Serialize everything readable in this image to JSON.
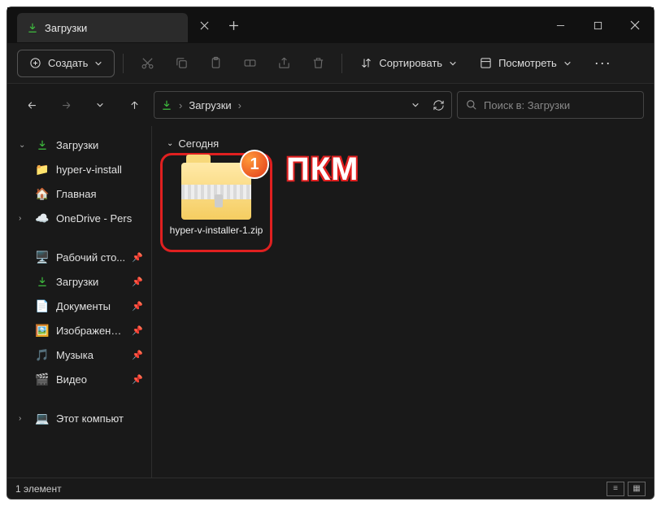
{
  "tab": {
    "title": "Загрузки"
  },
  "toolbar": {
    "create": "Создать",
    "sort": "Сортировать",
    "view": "Посмотреть"
  },
  "breadcrumb": {
    "item": "Загрузки"
  },
  "search": {
    "placeholder": "Поиск в: Загрузки"
  },
  "sidebar": {
    "downloads": "Загрузки",
    "child_file": "hyper-v-install",
    "home": "Главная",
    "onedrive": "OneDrive - Pers",
    "desktop": "Рабочий сто...",
    "downloads2": "Загрузки",
    "documents": "Документы",
    "pictures": "Изображени...",
    "music": "Музыка",
    "videos": "Видео",
    "this_pc": "Этот компьют"
  },
  "content": {
    "group": "Сегодня",
    "file_name": "hyper-v-installer-1.zip"
  },
  "annotation": {
    "badge": "1",
    "text": "ПКМ"
  },
  "status": {
    "count": "1 элемент"
  },
  "colors": {
    "highlight": "#e02020",
    "accent": "#3fbf3f"
  }
}
